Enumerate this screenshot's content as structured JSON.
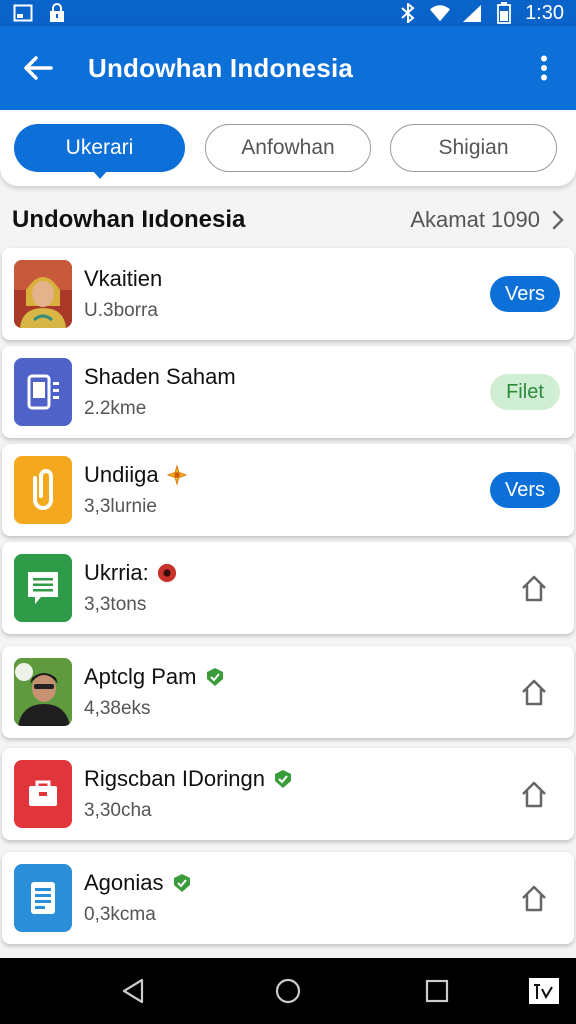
{
  "status_bar": {
    "time": "1:30"
  },
  "app_bar": {
    "title": "Undowhan Indonesia"
  },
  "tabs": [
    {
      "label": "Ukerari",
      "active": true
    },
    {
      "label": "Anfowhan",
      "active": false
    },
    {
      "label": "Shigian",
      "active": false
    }
  ],
  "section": {
    "title": "Undowhan Iıdonesia",
    "link": "Akamat 1090"
  },
  "items": [
    {
      "name": "Vkaitien",
      "sub": "U.3borra",
      "action": "Vers",
      "icon": "person-photo"
    },
    {
      "name": "Shaden Saham",
      "sub": "2.2kme",
      "action": "Filet",
      "icon": "phone-app-icon"
    },
    {
      "name": "Undiiga",
      "sub": "3,3lurnie",
      "action": "Vers",
      "icon": "clip-app-icon"
    },
    {
      "name": "Ukrria:",
      "sub": "3,3tons",
      "action": "",
      "icon": "message-app-icon"
    },
    {
      "name": "Aptclg Pam",
      "sub": "4,38eks",
      "action": "",
      "icon": "person-photo"
    },
    {
      "name": "Rigscban IDoringn",
      "sub": "3,30cha",
      "action": "",
      "icon": "bag-app-icon"
    },
    {
      "name": "Agonias",
      "sub": "0,3kcma",
      "action": "",
      "icon": "document-app-icon"
    }
  ],
  "colors": {
    "primary": "#0d6fd8",
    "status_bar": "#0a63c9",
    "filet_bg": "#cfeed3",
    "filet_text": "#2e8a3c"
  }
}
